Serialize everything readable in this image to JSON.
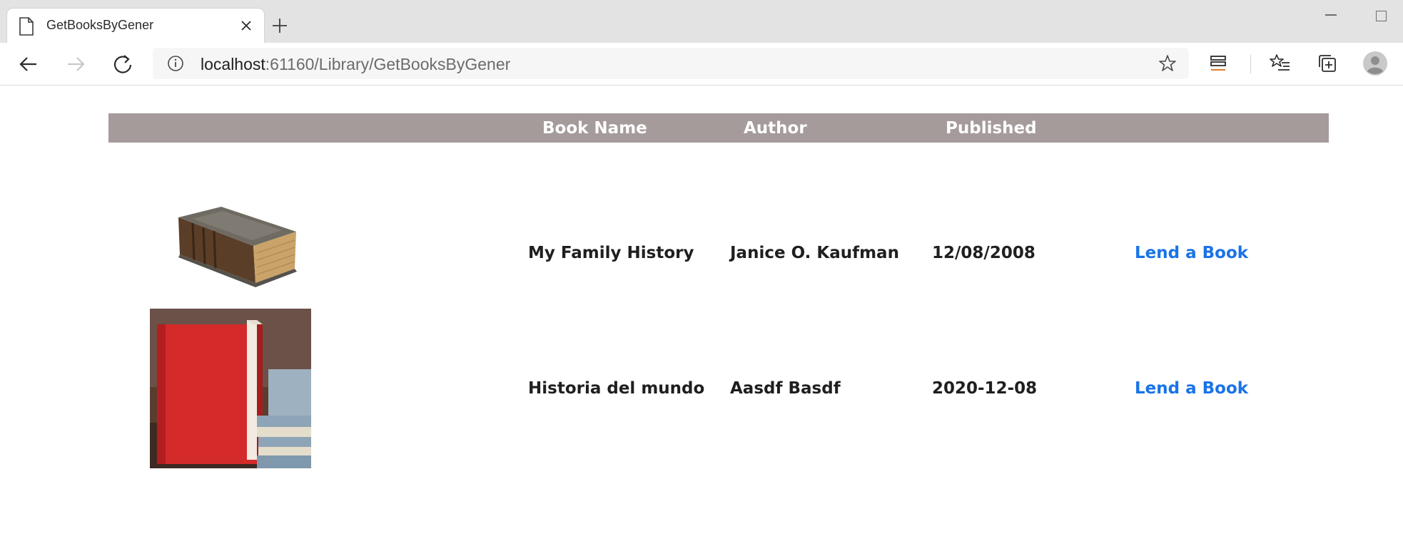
{
  "browser": {
    "tab_title": "GetBooksByGener",
    "url_host": "localhost",
    "url_rest": ":61160/Library/GetBooksByGener",
    "icons": {
      "page": "page-icon",
      "close": "close-icon",
      "new_tab": "plus-icon",
      "back": "back-arrow-icon",
      "forward": "forward-arrow-icon",
      "reload": "reload-icon",
      "info": "info-icon",
      "favorite": "star-icon",
      "reading_list": "reading-list-icon",
      "favorites": "favorites-icon",
      "collections": "collections-icon",
      "profile": "profile-icon"
    }
  },
  "table": {
    "header_bg": "#a59b9b",
    "columns": [
      "",
      "Book Name",
      "Author",
      "Published",
      ""
    ],
    "rows": [
      {
        "image": "old-brown-book-image",
        "name": "My Family History",
        "author": "Janice O. Kaufman",
        "published": "12/08/2008",
        "action": "Lend a Book"
      },
      {
        "image": "red-book-image",
        "name": "Historia del mundo",
        "author": "Aasdf Basdf",
        "published": "2020-12-08",
        "action": "Lend a Book"
      }
    ]
  },
  "colors": {
    "link": "#1a73e8"
  }
}
